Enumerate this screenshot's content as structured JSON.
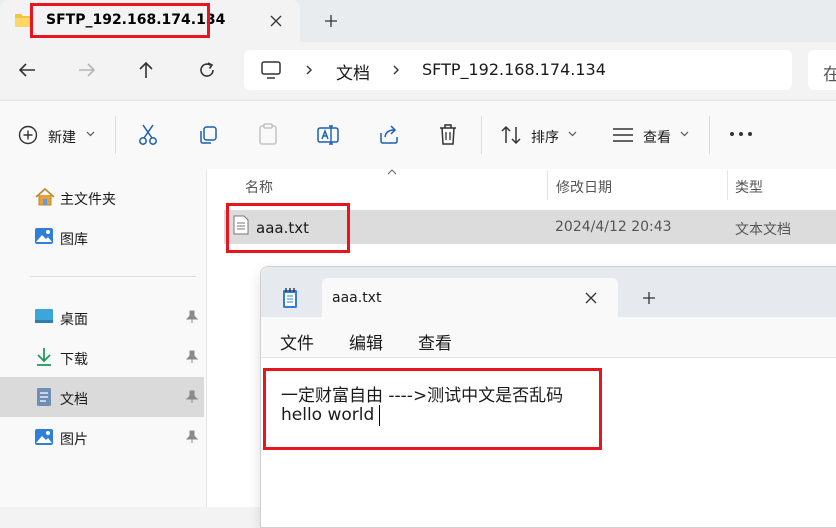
{
  "explorer": {
    "tab": {
      "title": "SFTP_192.168.174.134"
    },
    "breadcrumb": [
      "文档",
      "SFTP_192.168.174.134"
    ],
    "search_placeholder": "在",
    "toolbar": {
      "new_label": "新建",
      "sort_label": "排序",
      "view_label": "查看"
    },
    "sidebar": {
      "items": [
        {
          "label": "主文件夹",
          "icon": "home-icon"
        },
        {
          "label": "图库",
          "icon": "gallery-icon"
        },
        {
          "label": "桌面",
          "icon": "desktop-icon",
          "pinned": true
        },
        {
          "label": "下载",
          "icon": "download-icon",
          "pinned": true
        },
        {
          "label": "文档",
          "icon": "documents-icon",
          "pinned": true,
          "selected": true
        },
        {
          "label": "图片",
          "icon": "pictures-icon",
          "pinned": true
        }
      ]
    },
    "columns": {
      "name": "名称",
      "modified": "修改日期",
      "type": "类型"
    },
    "files": [
      {
        "name": "aaa.txt",
        "modified": "2024/4/12 20:43",
        "type": "文本文档"
      }
    ]
  },
  "notepad": {
    "tab_title": "aaa.txt",
    "menu": [
      "文件",
      "编辑",
      "查看"
    ],
    "lines": [
      "一定财富自由 ---->测试中文是否乱码",
      "hello world"
    ]
  },
  "colors": {
    "accent": "#0067c0",
    "highlight": "#e8141e",
    "folder": "#f5c342"
  }
}
